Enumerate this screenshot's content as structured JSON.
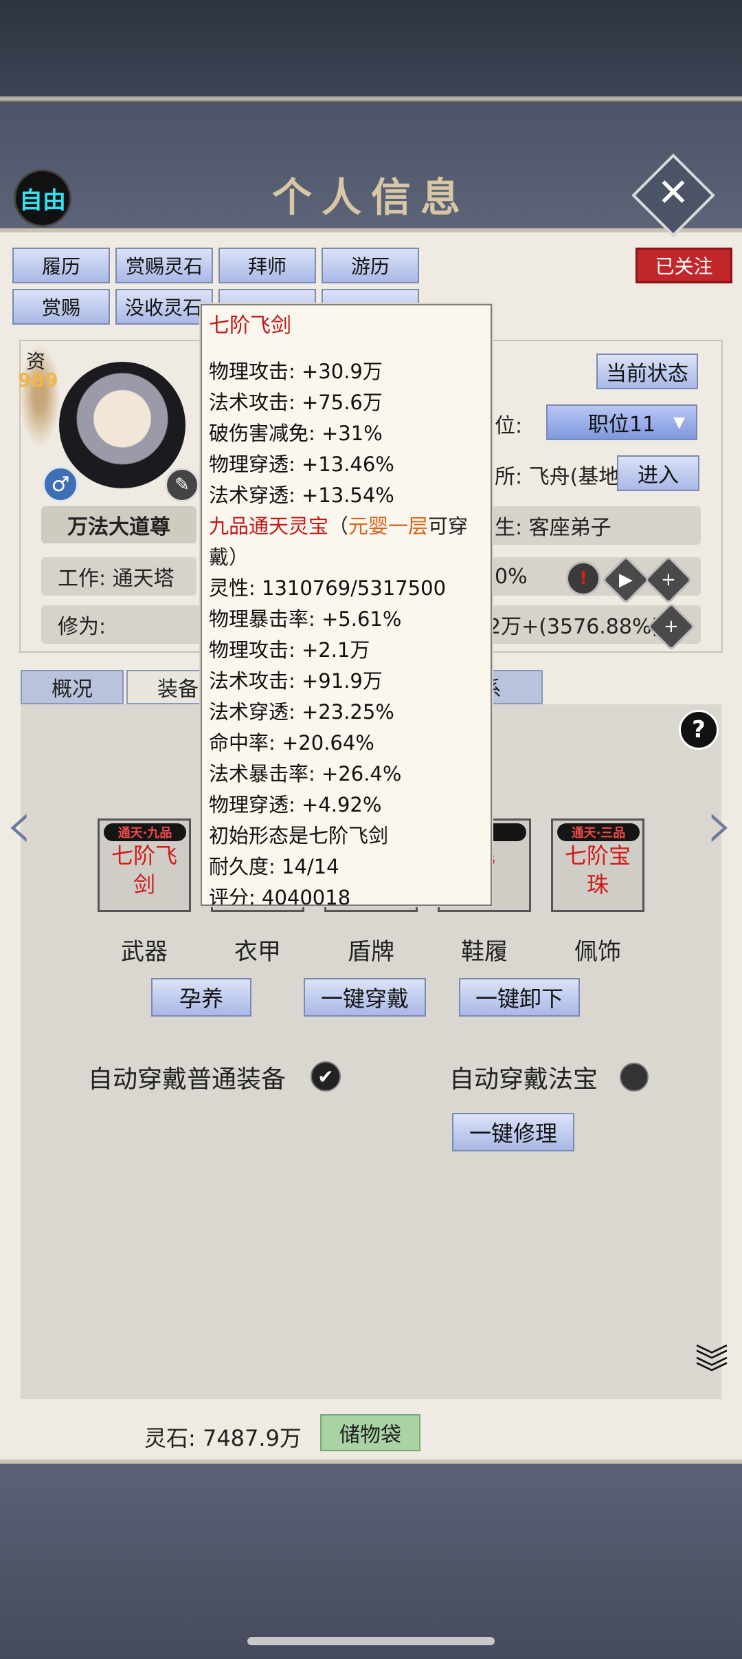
{
  "header": {
    "title": "个人信息",
    "free_label": "自由",
    "close_icon": "close-icon"
  },
  "top_buttons": [
    {
      "label": "履历"
    },
    {
      "label": "赏赐灵石"
    },
    {
      "label": "拜师"
    },
    {
      "label": "游历"
    },
    {
      "label": "赏赐"
    },
    {
      "label": "没收灵石"
    }
  ],
  "followed_label": "已关注",
  "profile": {
    "aptitude_label": "资",
    "aptitude_value": "989",
    "name": "万法大道尊",
    "work": "工作: 通天塔",
    "cultivation": "修为:",
    "status_button": "当前状态",
    "position_label": "位:",
    "position_value": "职位11",
    "location": "所: 飞舟(基地",
    "enter_button": "进入",
    "identity": "生:  客座弟子",
    "percent": "0%",
    "cultivation_progress": "2万+(3576.88%)"
  },
  "tabs": [
    "概况",
    "装备",
    "系"
  ],
  "equipment": {
    "slots": [
      {
        "name": "七阶飞剑",
        "line1": "七阶飞",
        "line2": "剑",
        "badge": "通天·九品",
        "label": "武器"
      },
      {
        "name": "",
        "line1": "",
        "line2": "",
        "badge": "",
        "label": "衣甲"
      },
      {
        "name": "",
        "line1": "",
        "line2": "",
        "badge": "",
        "label": "盾牌"
      },
      {
        "name": "七阶飞",
        "line1": "飞",
        "line2": "",
        "badge": "品",
        "label": "鞋履"
      },
      {
        "name": "七阶宝珠",
        "line1": "七阶宝",
        "line2": "珠",
        "badge": "通天·三品",
        "label": "佩饰"
      }
    ],
    "nurture_button": "孕养",
    "wear_all_button": "一键穿戴",
    "remove_all_button": "一键卸下",
    "auto_wear_normal": "自动穿戴普通装备",
    "auto_wear_treasure": "自动穿戴法宝",
    "repair_button": "一键修理"
  },
  "footer": {
    "spirit_stones": "灵石: 7487.9万",
    "bag_button": "储物袋"
  },
  "tooltip": {
    "title": "七阶飞剑",
    "stats1": [
      "物理攻击: +30.9万",
      "法术攻击: +75.6万",
      "破伤害减免: +31%",
      "物理穿透: +13.46%",
      "法术穿透: +13.54%"
    ],
    "grade": "九品通天灵宝",
    "realm_open": "（",
    "realm": "元婴一层",
    "wear_text": "可穿戴）",
    "stats2": [
      "灵性:  1310769/5317500",
      "物理暴击率: +5.61%",
      "物理攻击: +2.1万",
      "法术攻击: +91.9万",
      "法术穿透: +23.25%",
      "命中率: +20.64%",
      "法术暴击率: +26.4%",
      "物理穿透: +4.92%",
      "初始形态是七阶飞剑",
      "耐久度:  14/14",
      "评分:  4040018"
    ]
  }
}
